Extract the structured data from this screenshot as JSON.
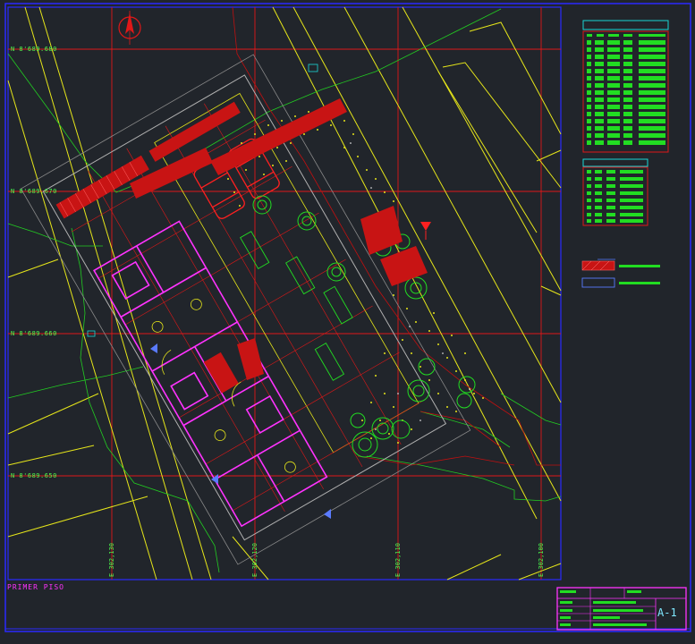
{
  "drawing": {
    "title": "PRIMER PISO",
    "sheet_number": "A-1",
    "grid_north": [
      "N 8'689.680",
      "N 8'689.670",
      "N 8'689.660",
      "N 8'689.650"
    ],
    "grid_east": [
      "E 302,130",
      "E 302,120",
      "E 302,110",
      "E 302,100"
    ]
  },
  "colors": {
    "background": "#21252b",
    "grid": "#e01818",
    "frame": "#2a2aff",
    "lot_lines": "#e6e61a",
    "walls": "#ff33ff",
    "vegetation": "#22dd22",
    "text": "#4dff4d"
  },
  "icons": [
    "north-arrow-icon",
    "tree-icon",
    "car-icon",
    "level-marker-icon"
  ]
}
